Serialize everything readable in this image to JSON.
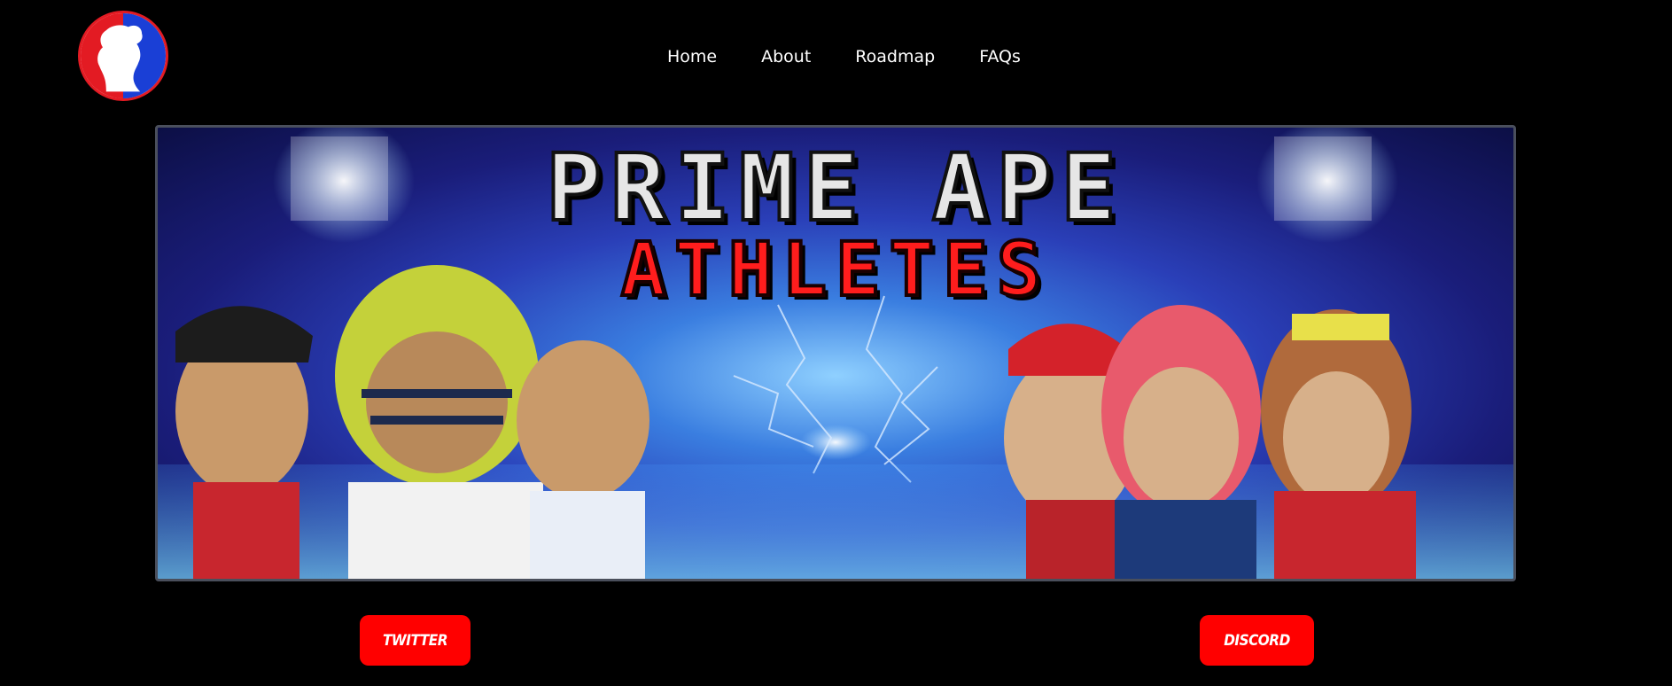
{
  "logo": {
    "icon": "ape-silhouette-logo-icon",
    "colors": [
      "#e31b23",
      "#1a3fd6",
      "#ffffff"
    ]
  },
  "nav": {
    "items": [
      {
        "label": "Home"
      },
      {
        "label": "About"
      },
      {
        "label": "Roadmap"
      },
      {
        "label": "FAQs"
      }
    ]
  },
  "banner": {
    "title_line_1": "PRIME APE",
    "title_line_2": "ATHLETES",
    "title_colors": {
      "line1": "#e6e6e6",
      "line2": "#ff1d1d"
    }
  },
  "social": {
    "twitter_label": "TWITTER",
    "discord_label": "DISCORD",
    "button_color": "#ff0000"
  }
}
